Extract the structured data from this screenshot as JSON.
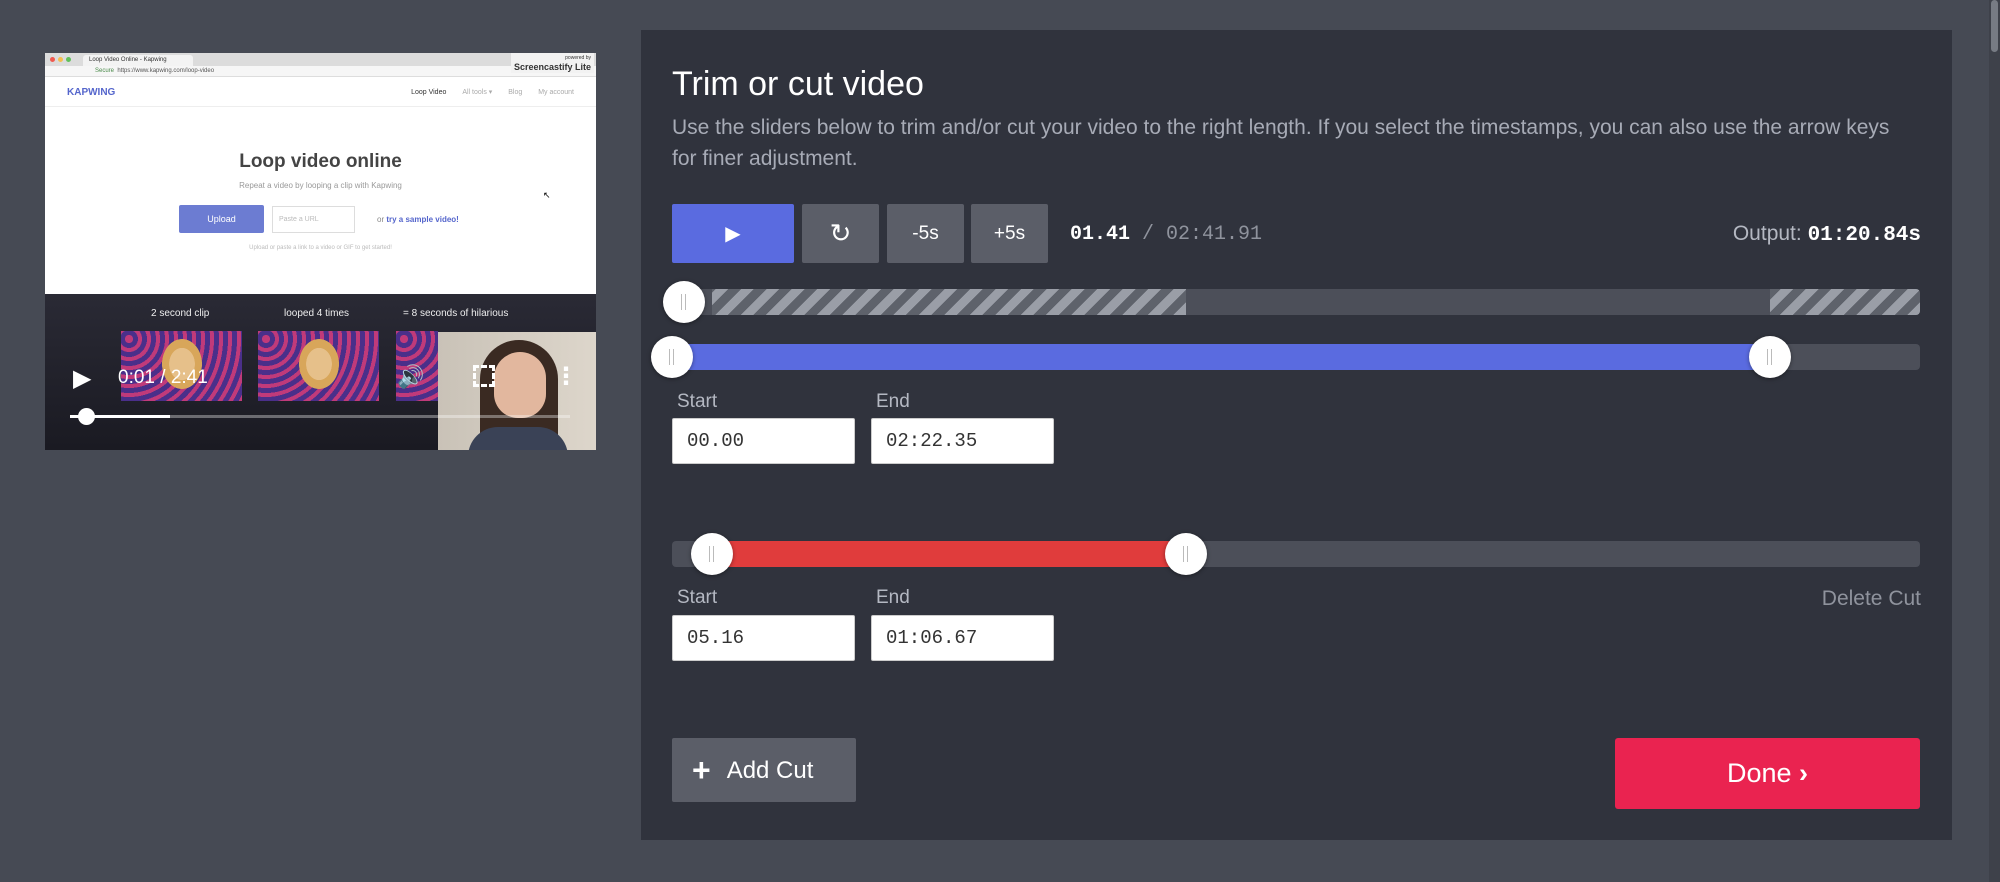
{
  "preview": {
    "tab_title": "Loop Video Online - Kapwing",
    "screencastify_small": "powered by",
    "screencastify": "Screencastify Lite",
    "secure": "Secure",
    "url": "https://www.kapwing.com/loop-video",
    "logo": "KAPWING",
    "nav": [
      "Loop Video",
      "All tools ▾",
      "Blog",
      "My account"
    ],
    "site_title": "Loop video online",
    "site_subtitle": "Repeat a video by looping a clip with Kapwing",
    "upload_label": "Upload",
    "url_placeholder": "Paste a URL",
    "or_text": "or",
    "sample_link": "try a sample video!",
    "hint": "Upload or paste a link to a video or GIF to get started!",
    "clip_labels": [
      "2 second clip",
      "looped 4 times",
      "= 8 seconds of hilarious"
    ],
    "player_time": "0:01 / 2:41",
    "player_progress": 0.2
  },
  "editor": {
    "title": "Trim or cut video",
    "description": "Use the sliders below to trim and/or cut your video to the right length. If you select the timestamps, you can also use the arrow keys for finer adjustment.",
    "minus5_label": "-5s",
    "plus5_label": "+5s",
    "current_time": "01.41",
    "time_separator": " / ",
    "total_time": "02:41.91",
    "output_label": "Output:",
    "output_value": "01:20.84s",
    "preview_playhead": 0.01,
    "trim": {
      "start_label": "Start",
      "end_label": "End",
      "start_value": "00.00",
      "end_value": "02:22.35",
      "start_fraction": 0.0,
      "end_fraction": 0.88
    },
    "cut": {
      "start_label": "Start",
      "end_label": "End",
      "start_value": "05.16",
      "end_value": "01:06.67",
      "start_fraction": 0.032,
      "end_fraction": 0.412,
      "delete_label": "Delete Cut"
    },
    "add_cut_label": "Add Cut",
    "done_label": "Done"
  },
  "colors": {
    "play": "#5a6be0",
    "cut": "#e03c3c",
    "done": "#ea2350"
  },
  "icons": {
    "play": "play-icon",
    "replay": "replay-icon",
    "plus": "plus-icon",
    "chevron": "chevron-right-icon",
    "volume": "volume-icon",
    "fullscreen": "fullscreen-icon",
    "more": "more-vertical-icon"
  }
}
